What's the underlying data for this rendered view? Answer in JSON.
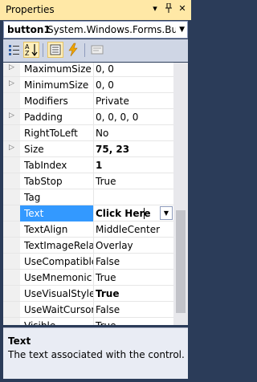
{
  "window": {
    "title": "Properties"
  },
  "object_selector": {
    "name": "button1",
    "type": "System.Windows.Forms.Butto"
  },
  "toolbar": {
    "buttons": [
      {
        "icon": "categorized-icon",
        "active": false
      },
      {
        "icon": "alphabetical-icon",
        "active": true
      },
      {
        "icon": "properties-icon",
        "active": true
      },
      {
        "icon": "events-icon",
        "active": false
      },
      {
        "icon": "property-pages-icon",
        "active": false
      }
    ]
  },
  "properties": [
    {
      "name": "MaximumSize",
      "value": "0, 0",
      "expandable": true,
      "bold": false
    },
    {
      "name": "MinimumSize",
      "value": "0, 0",
      "expandable": true,
      "bold": false
    },
    {
      "name": "Modifiers",
      "value": "Private",
      "expandable": false,
      "bold": false
    },
    {
      "name": "Padding",
      "value": "0, 0, 0, 0",
      "expandable": true,
      "bold": false
    },
    {
      "name": "RightToLeft",
      "value": "No",
      "expandable": false,
      "bold": false
    },
    {
      "name": "Size",
      "value": "75, 23",
      "expandable": true,
      "bold": true
    },
    {
      "name": "TabIndex",
      "value": "1",
      "expandable": false,
      "bold": true
    },
    {
      "name": "TabStop",
      "value": "True",
      "expandable": false,
      "bold": false
    },
    {
      "name": "Tag",
      "value": "",
      "expandable": false,
      "bold": false
    },
    {
      "name": "Text",
      "value": "Click Here",
      "expandable": false,
      "bold": true,
      "selected": true
    },
    {
      "name": "TextAlign",
      "value": "MiddleCenter",
      "expandable": false,
      "bold": false
    },
    {
      "name": "TextImageRelati",
      "value": "Overlay",
      "expandable": false,
      "bold": false
    },
    {
      "name": "UseCompatibleT",
      "value": "False",
      "expandable": false,
      "bold": false
    },
    {
      "name": "UseMnemonic",
      "value": "True",
      "expandable": false,
      "bold": false
    },
    {
      "name": "UseVisualStyleBa",
      "value": "True",
      "expandable": false,
      "bold": true
    },
    {
      "name": "UseWaitCursor",
      "value": "False",
      "expandable": false,
      "bold": false
    },
    {
      "name": "Visible",
      "value": "True",
      "expandable": false,
      "bold": false
    }
  ],
  "description": {
    "title": "Text",
    "text": "The text associated with the control."
  },
  "colors": {
    "title_bar": "#ffe8a6",
    "frame": "#2b3c59",
    "selection": "#3399ff"
  }
}
